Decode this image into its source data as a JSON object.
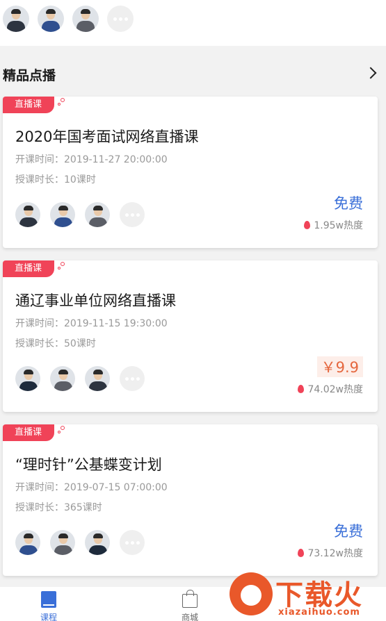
{
  "top": {
    "teachers": [
      "teacher-avatar",
      "teacher-avatar",
      "teacher-avatar"
    ]
  },
  "section": {
    "title": "精品点播"
  },
  "courses": [
    {
      "tag": "直播课",
      "title": "2020年国考面试网络直播课",
      "start_time": "开课时间：2019-11-27 20:00:00",
      "duration": "授课时长：10课时",
      "price": "免费",
      "heat": "1.95w热度"
    },
    {
      "tag": "直播课",
      "title": "通辽事业单位网络直播课",
      "start_time": "开课时间：2019-11-15 19:30:00",
      "duration": "授课时长：50课时",
      "price": "￥9.9",
      "heat": "74.02w热度"
    },
    {
      "tag": "直播课",
      "title": "“理时针”公基蝶变计划",
      "start_time": "开课时间：2019-07-15 07:00:00",
      "duration": "授课时长：365课时",
      "price": "免费",
      "heat": "73.12w热度"
    }
  ],
  "tabbar": {
    "courses_label": "课程",
    "mall_label": "商城"
  },
  "watermark": {
    "text": "下载火",
    "url": "xiazaihuo.com"
  },
  "colors": {
    "accent_blue": "#3a6fd8",
    "tag_red": "#f04358",
    "price_orange": "#e5673e"
  }
}
